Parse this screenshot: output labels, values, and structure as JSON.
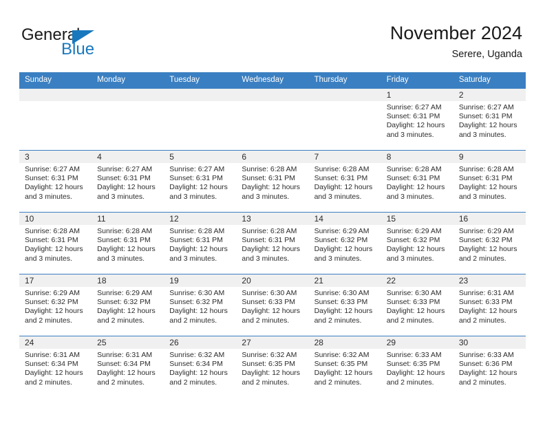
{
  "brand": {
    "name_part1": "General",
    "name_part2": "Blue",
    "accent_color": "#1878be"
  },
  "header": {
    "title": "November 2024",
    "subtitle": "Serere, Uganda"
  },
  "theme": {
    "header_row_color": "#3a7fc1",
    "daynum_band_color": "#f0f0f0",
    "text_color": "#2b2b2b"
  },
  "weekdays": [
    "Sunday",
    "Monday",
    "Tuesday",
    "Wednesday",
    "Thursday",
    "Friday",
    "Saturday"
  ],
  "labels": {
    "sunrise": "Sunrise:",
    "sunset": "Sunset:",
    "daylight": "Daylight:"
  },
  "weeks": [
    [
      {
        "day": "",
        "empty": true
      },
      {
        "day": "",
        "empty": true
      },
      {
        "day": "",
        "empty": true
      },
      {
        "day": "",
        "empty": true
      },
      {
        "day": "",
        "empty": true
      },
      {
        "day": "1",
        "sunrise": "Sunrise: 6:27 AM",
        "sunset": "Sunset: 6:31 PM",
        "daylight_1": "Daylight: 12 hours",
        "daylight_2": "and 3 minutes."
      },
      {
        "day": "2",
        "sunrise": "Sunrise: 6:27 AM",
        "sunset": "Sunset: 6:31 PM",
        "daylight_1": "Daylight: 12 hours",
        "daylight_2": "and 3 minutes."
      }
    ],
    [
      {
        "day": "3",
        "sunrise": "Sunrise: 6:27 AM",
        "sunset": "Sunset: 6:31 PM",
        "daylight_1": "Daylight: 12 hours",
        "daylight_2": "and 3 minutes."
      },
      {
        "day": "4",
        "sunrise": "Sunrise: 6:27 AM",
        "sunset": "Sunset: 6:31 PM",
        "daylight_1": "Daylight: 12 hours",
        "daylight_2": "and 3 minutes."
      },
      {
        "day": "5",
        "sunrise": "Sunrise: 6:27 AM",
        "sunset": "Sunset: 6:31 PM",
        "daylight_1": "Daylight: 12 hours",
        "daylight_2": "and 3 minutes."
      },
      {
        "day": "6",
        "sunrise": "Sunrise: 6:28 AM",
        "sunset": "Sunset: 6:31 PM",
        "daylight_1": "Daylight: 12 hours",
        "daylight_2": "and 3 minutes."
      },
      {
        "day": "7",
        "sunrise": "Sunrise: 6:28 AM",
        "sunset": "Sunset: 6:31 PM",
        "daylight_1": "Daylight: 12 hours",
        "daylight_2": "and 3 minutes."
      },
      {
        "day": "8",
        "sunrise": "Sunrise: 6:28 AM",
        "sunset": "Sunset: 6:31 PM",
        "daylight_1": "Daylight: 12 hours",
        "daylight_2": "and 3 minutes."
      },
      {
        "day": "9",
        "sunrise": "Sunrise: 6:28 AM",
        "sunset": "Sunset: 6:31 PM",
        "daylight_1": "Daylight: 12 hours",
        "daylight_2": "and 3 minutes."
      }
    ],
    [
      {
        "day": "10",
        "sunrise": "Sunrise: 6:28 AM",
        "sunset": "Sunset: 6:31 PM",
        "daylight_1": "Daylight: 12 hours",
        "daylight_2": "and 3 minutes."
      },
      {
        "day": "11",
        "sunrise": "Sunrise: 6:28 AM",
        "sunset": "Sunset: 6:31 PM",
        "daylight_1": "Daylight: 12 hours",
        "daylight_2": "and 3 minutes."
      },
      {
        "day": "12",
        "sunrise": "Sunrise: 6:28 AM",
        "sunset": "Sunset: 6:31 PM",
        "daylight_1": "Daylight: 12 hours",
        "daylight_2": "and 3 minutes."
      },
      {
        "day": "13",
        "sunrise": "Sunrise: 6:28 AM",
        "sunset": "Sunset: 6:31 PM",
        "daylight_1": "Daylight: 12 hours",
        "daylight_2": "and 3 minutes."
      },
      {
        "day": "14",
        "sunrise": "Sunrise: 6:29 AM",
        "sunset": "Sunset: 6:32 PM",
        "daylight_1": "Daylight: 12 hours",
        "daylight_2": "and 3 minutes."
      },
      {
        "day": "15",
        "sunrise": "Sunrise: 6:29 AM",
        "sunset": "Sunset: 6:32 PM",
        "daylight_1": "Daylight: 12 hours",
        "daylight_2": "and 3 minutes."
      },
      {
        "day": "16",
        "sunrise": "Sunrise: 6:29 AM",
        "sunset": "Sunset: 6:32 PM",
        "daylight_1": "Daylight: 12 hours",
        "daylight_2": "and 2 minutes."
      }
    ],
    [
      {
        "day": "17",
        "sunrise": "Sunrise: 6:29 AM",
        "sunset": "Sunset: 6:32 PM",
        "daylight_1": "Daylight: 12 hours",
        "daylight_2": "and 2 minutes."
      },
      {
        "day": "18",
        "sunrise": "Sunrise: 6:29 AM",
        "sunset": "Sunset: 6:32 PM",
        "daylight_1": "Daylight: 12 hours",
        "daylight_2": "and 2 minutes."
      },
      {
        "day": "19",
        "sunrise": "Sunrise: 6:30 AM",
        "sunset": "Sunset: 6:32 PM",
        "daylight_1": "Daylight: 12 hours",
        "daylight_2": "and 2 minutes."
      },
      {
        "day": "20",
        "sunrise": "Sunrise: 6:30 AM",
        "sunset": "Sunset: 6:33 PM",
        "daylight_1": "Daylight: 12 hours",
        "daylight_2": "and 2 minutes."
      },
      {
        "day": "21",
        "sunrise": "Sunrise: 6:30 AM",
        "sunset": "Sunset: 6:33 PM",
        "daylight_1": "Daylight: 12 hours",
        "daylight_2": "and 2 minutes."
      },
      {
        "day": "22",
        "sunrise": "Sunrise: 6:30 AM",
        "sunset": "Sunset: 6:33 PM",
        "daylight_1": "Daylight: 12 hours",
        "daylight_2": "and 2 minutes."
      },
      {
        "day": "23",
        "sunrise": "Sunrise: 6:31 AM",
        "sunset": "Sunset: 6:33 PM",
        "daylight_1": "Daylight: 12 hours",
        "daylight_2": "and 2 minutes."
      }
    ],
    [
      {
        "day": "24",
        "sunrise": "Sunrise: 6:31 AM",
        "sunset": "Sunset: 6:34 PM",
        "daylight_1": "Daylight: 12 hours",
        "daylight_2": "and 2 minutes."
      },
      {
        "day": "25",
        "sunrise": "Sunrise: 6:31 AM",
        "sunset": "Sunset: 6:34 PM",
        "daylight_1": "Daylight: 12 hours",
        "daylight_2": "and 2 minutes."
      },
      {
        "day": "26",
        "sunrise": "Sunrise: 6:32 AM",
        "sunset": "Sunset: 6:34 PM",
        "daylight_1": "Daylight: 12 hours",
        "daylight_2": "and 2 minutes."
      },
      {
        "day": "27",
        "sunrise": "Sunrise: 6:32 AM",
        "sunset": "Sunset: 6:35 PM",
        "daylight_1": "Daylight: 12 hours",
        "daylight_2": "and 2 minutes."
      },
      {
        "day": "28",
        "sunrise": "Sunrise: 6:32 AM",
        "sunset": "Sunset: 6:35 PM",
        "daylight_1": "Daylight: 12 hours",
        "daylight_2": "and 2 minutes."
      },
      {
        "day": "29",
        "sunrise": "Sunrise: 6:33 AM",
        "sunset": "Sunset: 6:35 PM",
        "daylight_1": "Daylight: 12 hours",
        "daylight_2": "and 2 minutes."
      },
      {
        "day": "30",
        "sunrise": "Sunrise: 6:33 AM",
        "sunset": "Sunset: 6:36 PM",
        "daylight_1": "Daylight: 12 hours",
        "daylight_2": "and 2 minutes."
      }
    ]
  ]
}
